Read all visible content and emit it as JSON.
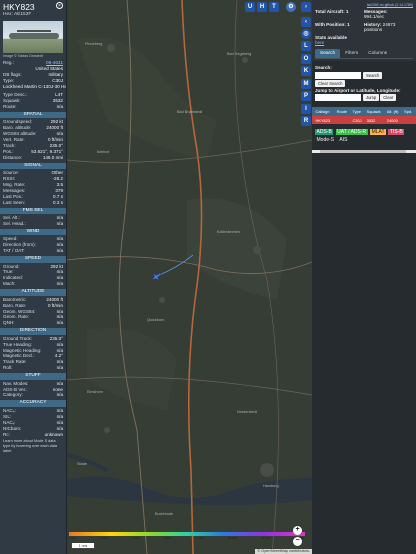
{
  "aircraft": {
    "callsign": "HKY823",
    "hex_label": "Hex:",
    "hex": "AE152F",
    "photo_credit": "Image © Tobias Ornstedt"
  },
  "info": [
    {
      "k": "Reg.:",
      "v": "06-4631",
      "link": true
    },
    {
      "k": "",
      "v": "United States"
    },
    {
      "k": "DB flags:",
      "v": "military"
    },
    {
      "k": "Type:",
      "v": "C30J"
    },
    {
      "k": "",
      "v": "Lockheed Martin C-130J-30 Hercules"
    }
  ],
  "info2": [
    {
      "k": "Type Desc.:",
      "v": "L4T"
    },
    {
      "k": "Squawk:",
      "v": "3532"
    },
    {
      "k": "Route:",
      "v": "n/a"
    }
  ],
  "sections": {
    "spatial": {
      "title": "SPATIAL",
      "rows": [
        {
          "k": "Groundspeed:",
          "v": "292 kt"
        },
        {
          "k": "Baro. altitude:",
          "v": "24000 ft"
        },
        {
          "k": "WGS84 altitude:",
          "v": "n/a"
        },
        {
          "k": "Vert. Rate:",
          "v": "0 ft/min"
        },
        {
          "k": "Track:",
          "v": "235.0°"
        },
        {
          "k": "Pos.:",
          "v": "53.621°, 9.371°"
        },
        {
          "k": "Distance:",
          "v": "146.0 nmi"
        }
      ]
    },
    "signal": {
      "title": "SIGNAL",
      "rows": [
        {
          "k": "Source:",
          "v": "Other"
        },
        {
          "k": "RSSI:",
          "v": "-28.2"
        },
        {
          "k": "Msg. Rate:",
          "v": "3.5"
        },
        {
          "k": "Messages:",
          "v": "379"
        },
        {
          "k": "",
          "v": ""
        },
        {
          "k": "Last Pos.:",
          "v": "0.7 s"
        },
        {
          "k": "Last Seen:",
          "v": "0.3 s"
        }
      ]
    },
    "fms": {
      "title": "FMS SEL",
      "rows": [
        {
          "k": "Sel. Alt.:",
          "v": "n/a"
        },
        {
          "k": "Sel. Head.:",
          "v": "n/a"
        }
      ]
    },
    "wind": {
      "title": "WIND",
      "rows": [
        {
          "k": "Speed:",
          "v": "n/a"
        },
        {
          "k": "Direction (from):",
          "v": "n/a"
        },
        {
          "k": "TAT / OAT:",
          "v": "n/a"
        }
      ]
    },
    "speed": {
      "title": "SPEED",
      "rows": [
        {
          "k": "Ground:",
          "v": "292 kt"
        },
        {
          "k": "True:",
          "v": "n/a"
        },
        {
          "k": "Indicated:",
          "v": "n/a"
        },
        {
          "k": "Mach:",
          "v": "n/a"
        }
      ]
    },
    "altitude": {
      "title": "ALTITUDE",
      "rows": [
        {
          "k": "Barometric:",
          "v": "24000 ft"
        },
        {
          "k": "Baro. Rate:",
          "v": "0 ft/min"
        },
        {
          "k": "Geom. WGS84:",
          "v": "n/a"
        },
        {
          "k": "Geom. Rate:",
          "v": "n/a"
        },
        {
          "k": "QNH:",
          "v": "n/a"
        }
      ]
    },
    "direction": {
      "title": "DIRECTION",
      "rows": [
        {
          "k": "Ground Track:",
          "v": "235.0°"
        },
        {
          "k": "True Heading:",
          "v": "n/a"
        },
        {
          "k": "Magnetic Heading:",
          "v": "n/a"
        },
        {
          "k": "Magnetic Decl.:",
          "v": "4.2°"
        },
        {
          "k": "Track Rate:",
          "v": "n/a"
        },
        {
          "k": "Roll:",
          "v": "n/a"
        }
      ]
    },
    "stuff": {
      "title": "STUFF",
      "rows": [
        {
          "k": "Nav. Modes:",
          "v": "n/a"
        },
        {
          "k": "ADS-B Ver.:",
          "v": "none"
        },
        {
          "k": "Category:",
          "v": "n/a"
        }
      ]
    },
    "accuracy": {
      "title": "ACCURACY",
      "rows": [
        {
          "k": "NACₚ:",
          "v": "n/a"
        },
        {
          "k": "SIL:",
          "v": "n/a"
        },
        {
          "k": "NACᵥ:",
          "v": "n/a"
        },
        {
          "k": "NICbaro:",
          "v": "n/a"
        },
        {
          "k": "Rc:",
          "v": "unknown"
        }
      ]
    }
  },
  "footer_note": "Learn more about Mode S data type by hovering over each data label.",
  "map": {
    "buttons": {
      "u": "U",
      "h": "H",
      "t": "T"
    },
    "side_buttons": [
      "L",
      "O",
      "K",
      "M",
      "P",
      "I",
      "R"
    ],
    "scale": "1 nmi",
    "legend_ticks": [
      "2,000",
      "4,000",
      "6,000",
      "8,000",
      "10,000",
      "20,000",
      "30,000",
      "40,000+"
    ],
    "attribution": "© OpenStreetMap contributors.",
    "city_labels": [
      "Hamburg",
      "Buxtehude",
      "Stade",
      "Elmshorn",
      "Pinneberg",
      "Bad Segeberg",
      "Neumünster",
      "Itzehoe",
      "Bad Bramstedt",
      "Kaltenkirchen",
      "Quickborn",
      "Norderstedt"
    ]
  },
  "sidebar": {
    "top_link": "tar1090 on github (2.14.1789)",
    "total_label": "Total Aircraft:",
    "total": "1",
    "messages_label": "Messages:",
    "messages": "994.1/sec",
    "withpos_label": "With Position:",
    "withpos": "1",
    "history_label": "History:",
    "history": "24673 positions",
    "stats_label": "Stats available",
    "stats_link": "here",
    "tabs": [
      "Search",
      "Filters",
      "Columns"
    ],
    "search_label": "Search:",
    "search_btn": "Search",
    "clear_search_btn": "Clear Search",
    "jump_label": "Jump to Airport or Latitude, Longitude:",
    "jump_btn": "Jump",
    "clear_btn": "Clear",
    "table_headers": [
      "",
      "Callsign",
      "Route",
      "Type",
      "Squawk",
      "Alt. (ft)",
      "Spd."
    ],
    "table_row": [
      "",
      "HKY823",
      "",
      "C30J",
      "3532",
      "24000",
      ""
    ],
    "sources": {
      "adsb": "ADS-B",
      "uat": "UAT / ADS-R",
      "mlat": "MLAT",
      "tis": "TIS-B",
      "modes": "Mode-S",
      "ais": "AIS"
    }
  }
}
